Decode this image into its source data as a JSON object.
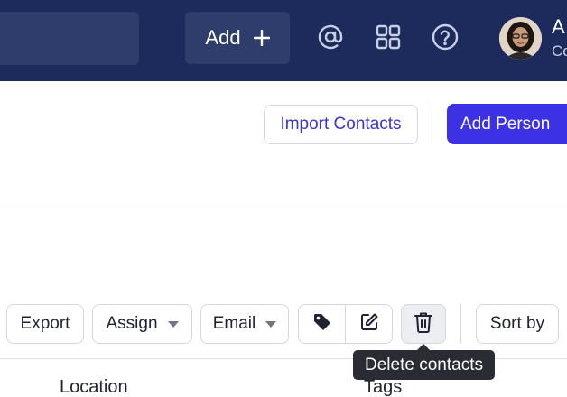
{
  "topbar": {
    "add_label": "Add",
    "user_name": "A",
    "user_subtitle": "Co",
    "icons": [
      "at-icon",
      "apps-grid-icon",
      "help-icon"
    ]
  },
  "header_actions": {
    "import_label": "Import Contacts",
    "add_person_label": "Add Person"
  },
  "toolbar": {
    "export_label": "Export",
    "assign_label": "Assign",
    "email_label": "Email",
    "sort_label": "Sort by",
    "tooltip": "Delete contacts"
  },
  "table": {
    "columns": [
      "Location",
      "Tags"
    ]
  },
  "colors": {
    "topbar": "#1c2a5c",
    "accent": "#3d31e6",
    "tooltip": "#2a2c33"
  }
}
